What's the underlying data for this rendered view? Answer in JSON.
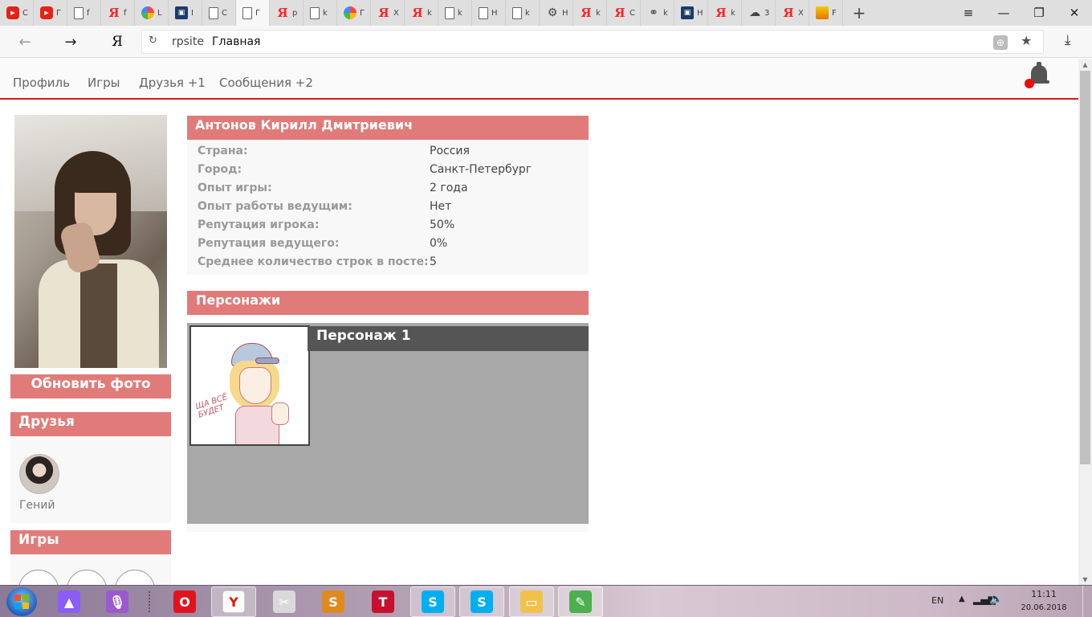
{
  "browser": {
    "tabs": [
      {
        "icon": "youtube-icon",
        "label": "C"
      },
      {
        "icon": "youtube-icon",
        "label": "Г"
      },
      {
        "icon": "document-icon",
        "label": "f"
      },
      {
        "icon": "yandex-icon",
        "label": "f"
      },
      {
        "icon": "color-wheel-icon",
        "label": "L"
      },
      {
        "icon": "dark-logo-icon",
        "label": "I"
      },
      {
        "icon": "document-icon",
        "label": "C"
      },
      {
        "icon": "document-icon",
        "label": "Г",
        "active": true
      },
      {
        "icon": "yandex-icon",
        "label": "p"
      },
      {
        "icon": "document-icon",
        "label": "k"
      },
      {
        "icon": "color-wheel-icon",
        "label": "Г"
      },
      {
        "icon": "yandex-icon",
        "label": "X"
      },
      {
        "icon": "yandex-icon",
        "label": "k"
      },
      {
        "icon": "document-icon",
        "label": "k"
      },
      {
        "icon": "document-icon",
        "label": "H"
      },
      {
        "icon": "document-icon",
        "label": "k"
      },
      {
        "icon": "gear-icon",
        "label": "H"
      },
      {
        "icon": "yandex-icon",
        "label": "k"
      },
      {
        "icon": "yandex-icon",
        "label": "C"
      },
      {
        "icon": "network-icon",
        "label": "k"
      },
      {
        "icon": "dark-logo-icon",
        "label": "H"
      },
      {
        "icon": "yandex-icon",
        "label": "k"
      },
      {
        "icon": "cloud-icon",
        "label": "3"
      },
      {
        "icon": "yandex-icon",
        "label": "X"
      },
      {
        "icon": "image-icon",
        "label": "F"
      }
    ],
    "new_tab": "+",
    "window_controls": {
      "menu": "≡",
      "minimize": "—",
      "restore": "❐",
      "close": "✕"
    },
    "back": "←",
    "forward": "→",
    "yandex_logo": "Я",
    "reload": "↻",
    "url_host": "rpsite",
    "url_title": "Главная",
    "globe": "⊕",
    "star": "★",
    "download": "⤓"
  },
  "site_nav": {
    "items": [
      "Профиль",
      "Игры",
      "Друзья +1",
      "Сообщения +2"
    ]
  },
  "sidebar": {
    "update_photo": "Обновить фото",
    "friends_title": "Друзья",
    "friend_name": "Гений",
    "games_title": "Игры"
  },
  "profile": {
    "name": "Антонов Кирилл Дмитриевич",
    "fields": [
      {
        "label": "Страна:",
        "value": "Россия"
      },
      {
        "label": "Город:",
        "value": "Санкт-Петербург"
      },
      {
        "label": "Опыт игры:",
        "value": "2 года"
      },
      {
        "label": "Опыт работы ведущим:",
        "value": "Нет"
      },
      {
        "label": "Репутация игрока:",
        "value": "50%"
      },
      {
        "label": "Репутация ведущего:",
        "value": "0%"
      },
      {
        "label": "Среднее количество строк в посте:",
        "value": "5"
      }
    ]
  },
  "characters": {
    "title": "Персонажи",
    "items": [
      {
        "name": "Персонаж 1",
        "sketch_text": "ЩА ВСЁ БУДЕТ"
      }
    ]
  },
  "taskbar": {
    "lang": "EN",
    "time": "11:11",
    "date": "20.06.2018",
    "apps": [
      {
        "name": "alice-icon",
        "color": "#8b5cf6",
        "glyph": "▲"
      },
      {
        "name": "microphone-icon",
        "color": "#9b59d0",
        "glyph": "🎙"
      },
      {
        "name": "opera-icon",
        "color": "#e0141e",
        "glyph": "O"
      },
      {
        "name": "yandex-browser-icon",
        "color": "#ffffff",
        "glyph": "Y",
        "open": true
      },
      {
        "name": "scissors-icon",
        "color": "#d9d9d9",
        "glyph": "✂"
      },
      {
        "name": "s-app-icon",
        "color": "#e08a1e",
        "glyph": "S"
      },
      {
        "name": "t-app-icon",
        "color": "#c8102e",
        "glyph": "T"
      },
      {
        "name": "skype-icon",
        "color": "#00aff0",
        "glyph": "S",
        "open": true
      },
      {
        "name": "skype-alt-icon",
        "color": "#00aff0",
        "glyph": "S",
        "open": true
      },
      {
        "name": "file-explorer-icon",
        "color": "#f0c24b",
        "glyph": "▭",
        "open": true
      },
      {
        "name": "notepad-icon",
        "color": "#4caf50",
        "glyph": "✎",
        "open": true
      }
    ]
  },
  "colors": {
    "accent": "#e07b79",
    "nav_border": "#d81a1a",
    "character_bar": "#555555",
    "character_bg": "#a8a8a8"
  }
}
